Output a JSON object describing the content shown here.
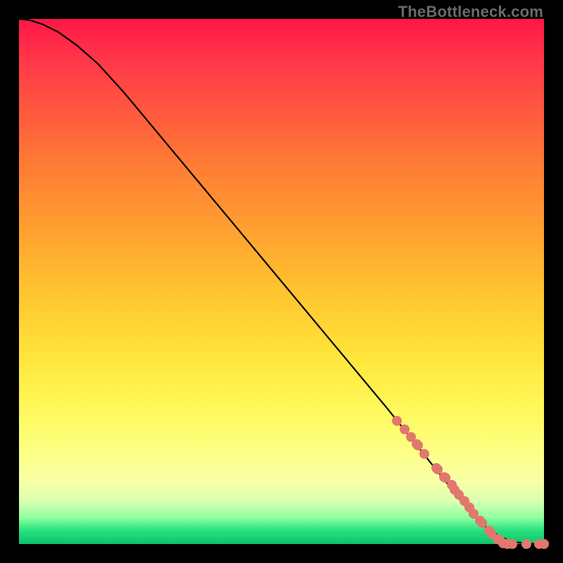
{
  "watermark": "TheBottleneck.com",
  "chart_data": {
    "type": "line",
    "title": "",
    "xlabel": "",
    "ylabel": "",
    "xlim": [
      0,
      1
    ],
    "ylim": [
      0,
      1
    ],
    "grid": false,
    "series": [
      {
        "name": "curve",
        "kind": "line",
        "x": [
          0.0,
          0.02,
          0.045,
          0.075,
          0.11,
          0.15,
          0.2,
          0.3,
          0.4,
          0.5,
          0.6,
          0.7,
          0.8,
          0.85,
          0.87,
          0.89,
          0.91,
          0.93,
          0.95,
          0.97,
          0.985,
          1.0
        ],
        "y": [
          1.0,
          0.998,
          0.99,
          0.975,
          0.95,
          0.915,
          0.86,
          0.74,
          0.62,
          0.5,
          0.38,
          0.26,
          0.135,
          0.072,
          0.05,
          0.032,
          0.018,
          0.008,
          0.003,
          0.001,
          0.0,
          0.0
        ]
      },
      {
        "name": "points",
        "kind": "scatter",
        "x": [
          0.72,
          0.734,
          0.746,
          0.758,
          0.76,
          0.772,
          0.795,
          0.798,
          0.81,
          0.812,
          0.824,
          0.83,
          0.838,
          0.848,
          0.858,
          0.866,
          0.878,
          0.882,
          0.895,
          0.9,
          0.912,
          0.915,
          0.922,
          0.93,
          0.94,
          0.966,
          0.99,
          1.0
        ],
        "y": [
          0.235,
          0.218,
          0.204,
          0.19,
          0.188,
          0.172,
          0.145,
          0.142,
          0.128,
          0.126,
          0.112,
          0.103,
          0.094,
          0.082,
          0.07,
          0.058,
          0.044,
          0.04,
          0.026,
          0.02,
          0.01,
          0.008,
          0.002,
          0.0,
          0.0,
          0.0,
          0.0,
          0.0
        ]
      }
    ]
  }
}
